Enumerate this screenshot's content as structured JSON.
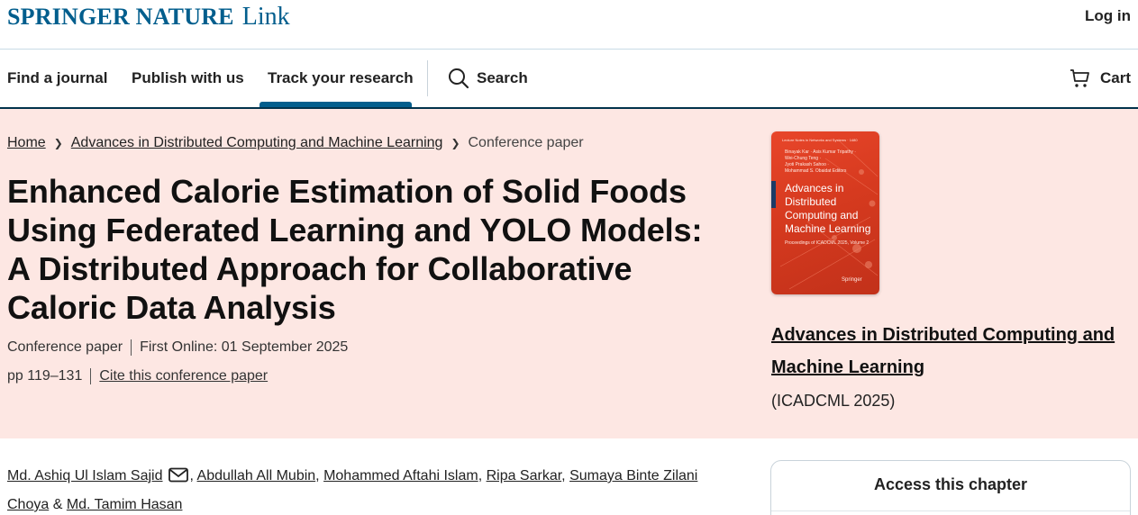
{
  "header": {
    "brand": "SPRINGER NATURE",
    "brand_suffix": "Link",
    "login_label": "Log in"
  },
  "nav": {
    "items": [
      {
        "label": "Find a journal"
      },
      {
        "label": "Publish with us"
      },
      {
        "label": "Track your research",
        "active": true
      }
    ],
    "search_label": "Search",
    "cart_label": "Cart"
  },
  "breadcrumb": {
    "home": "Home",
    "book": "Advances in Distributed Computing and Machine Learning",
    "current": "Conference paper"
  },
  "article": {
    "title": "Enhanced Calorie Estimation of Solid Foods Using Federated Learning and YOLO Models: A Distributed Approach for Collaborative Caloric Data Analysis",
    "type": "Conference paper",
    "first_online": "First Online: 01 September 2025",
    "pages": "pp 119–131",
    "cite_label": "Cite this conference paper"
  },
  "book": {
    "cover": {
      "series": "Lecture Notes in Networks and Systems · 1480",
      "editors": [
        "Binayak Kar · Asis Kumar Tripathy ·",
        "Wei-Chung Teng ·",
        "Jyoti Prakash Sahoo ·",
        "Mohammad S. Obaidat  Editors"
      ],
      "title": "Advances in Distributed Computing and Machine Learning",
      "proceedings": "Proceedings of ICADCML 2025, Volume 2",
      "publisher": "Springer"
    },
    "title": "Advances in Distributed Computing and Machine Learning",
    "conference": "(ICADCML 2025)"
  },
  "authors": [
    {
      "name": "Md. Ashiq Ul Islam Sajid",
      "email_icon": true
    },
    {
      "name": "Abdullah All Mubin"
    },
    {
      "name": "Mohammed Aftahi Islam"
    },
    {
      "name": "Ripa Sarkar"
    },
    {
      "name": "Sumaya Binte Zilani Choya"
    },
    {
      "name": "Md. Tamim Hasan"
    }
  ],
  "access": {
    "title": "Access this chapter"
  },
  "colors": {
    "brand": "#025e8d",
    "hero_bg": "#fde7e3",
    "nav_border": "#01324b",
    "cover": "#d63a1f"
  }
}
